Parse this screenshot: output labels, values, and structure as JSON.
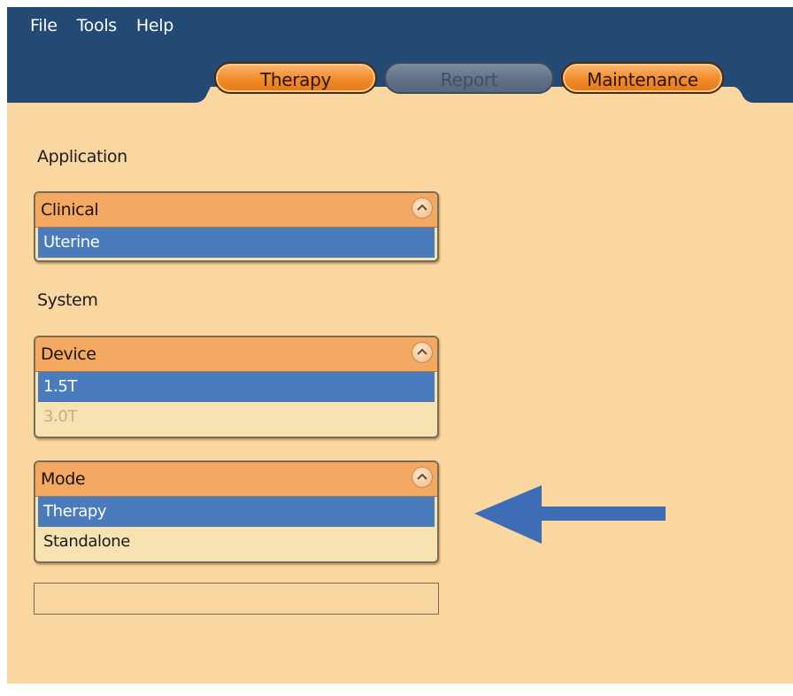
{
  "menu": [
    "File",
    "Tools",
    "Help"
  ],
  "tabs": [
    {
      "label": "Therapy",
      "state": "active"
    },
    {
      "label": "Report",
      "state": "disabled"
    },
    {
      "label": "Maintenance",
      "state": "active"
    }
  ],
  "application": {
    "section_label": "Application",
    "listbox": {
      "title": "Clinical",
      "items": [
        {
          "label": "Uterine",
          "selected": true
        }
      ]
    }
  },
  "system": {
    "section_label": "System",
    "device": {
      "title": "Device",
      "items": [
        {
          "label": "1.5T",
          "selected": true
        },
        {
          "label": "3.0T",
          "selected": false,
          "disabled": true
        }
      ]
    },
    "mode": {
      "title": "Mode",
      "items": [
        {
          "label": "Therapy",
          "selected": true
        },
        {
          "label": "Standalone",
          "selected": false
        }
      ]
    }
  },
  "colors": {
    "header_bg": "#224a75",
    "panel_bg": "#fad7a0",
    "tab_orange": "#f28c28",
    "selected_row": "#4a7bbd",
    "arrow": "#3e6db5"
  },
  "icons": {
    "collapse": "chevron-up-icon",
    "pointer": "arrow-left-icon"
  }
}
